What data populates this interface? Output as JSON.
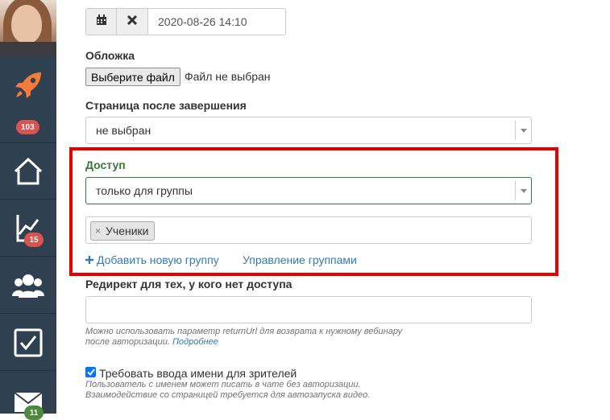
{
  "sidebar": {
    "badges": {
      "rocket": "103",
      "analytics": "15",
      "mail": "11"
    },
    "icons": [
      "rocket-icon",
      "home-icon",
      "chart-icon",
      "users-icon",
      "checkbox-icon",
      "mail-icon"
    ]
  },
  "form": {
    "date": {
      "value": "2020-08-26 14:10"
    },
    "cover": {
      "label": "Обложка",
      "button": "Выберите файл",
      "status": "Файл не выбран"
    },
    "after_page": {
      "label": "Страница после завершения",
      "value": "не выбран"
    },
    "access": {
      "label": "Доступ",
      "value": "только для группы",
      "tags": [
        "Ученики"
      ],
      "tag_remove": "×",
      "add_group": "Добавить новую группу",
      "manage_groups": "Управление группами"
    },
    "redirect": {
      "label": "Редирект для тех, у кого нет доступа",
      "value": "",
      "help_line1": "Можно использовать параметр returnUrl для возврата к нужному вебинару",
      "help_line2": "после авторизации.",
      "help_link": "Подробнее"
    },
    "require_name": {
      "checked": true,
      "label": "Требовать ввода имени для зрителей",
      "help_line1": "Пользователь с именем может писать в чате без авторизации.",
      "help_line2": "Взаимодействие со страницей требуется для автозапуска видео."
    }
  },
  "colors": {
    "sidebar": "#2f4050",
    "accent_orange": "#f47b39",
    "link": "#337ab7",
    "success": "#3c763d",
    "highlight": "#e60000",
    "badge_red": "#d9534f",
    "badge_green": "#4f8a3c"
  }
}
